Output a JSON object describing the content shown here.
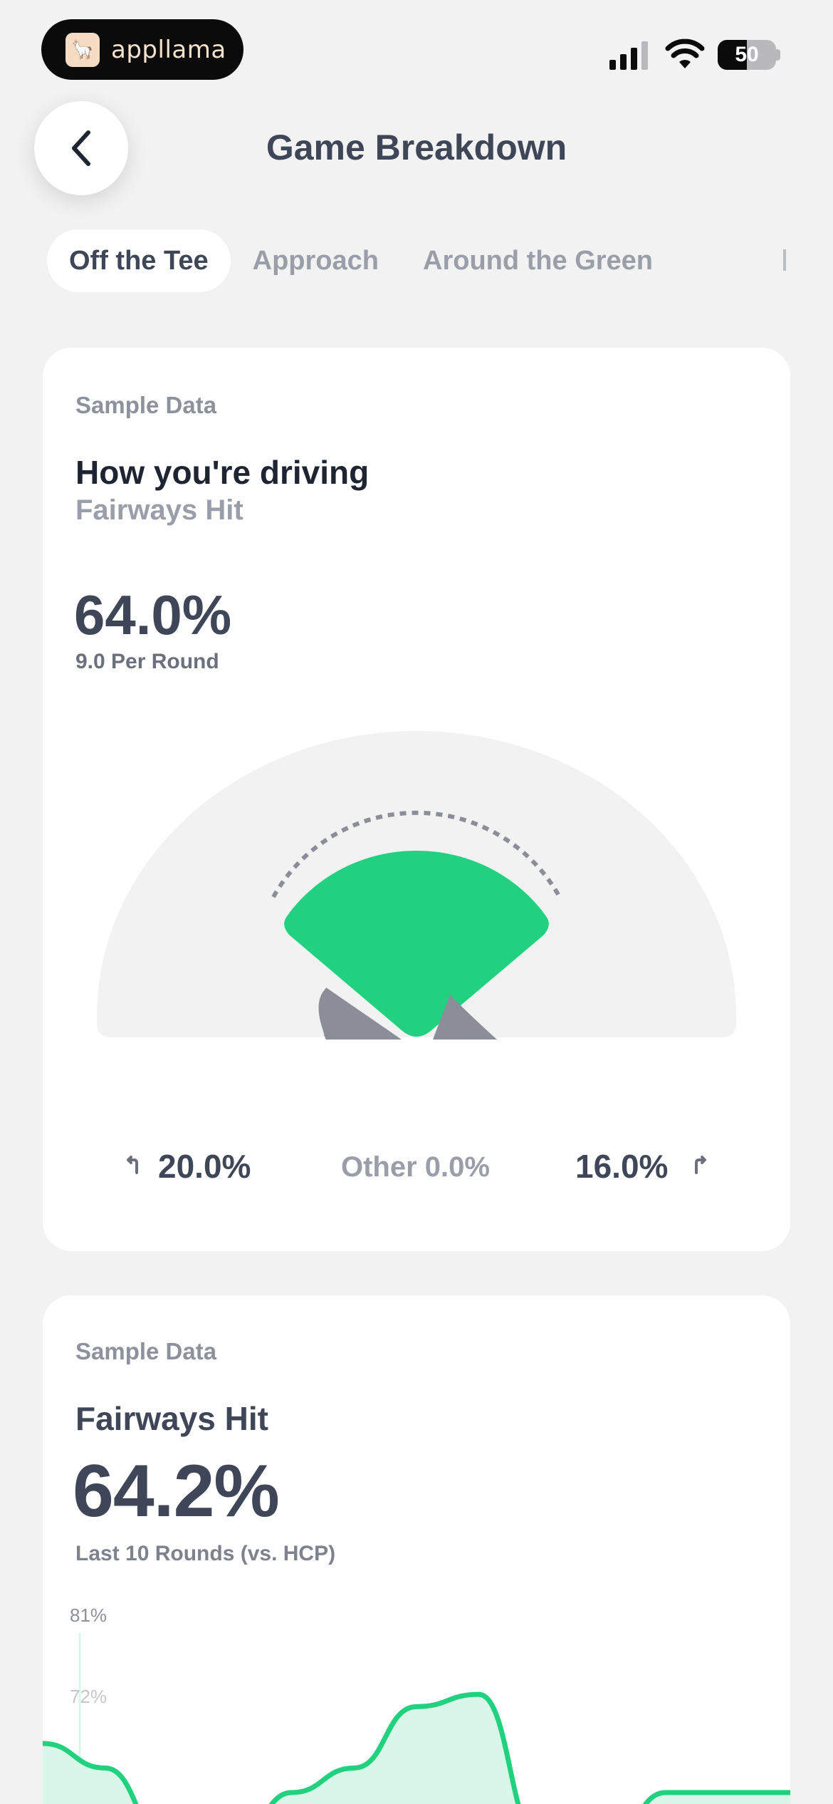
{
  "status_bar": {
    "app_badge": "appllama",
    "battery": "50"
  },
  "header": {
    "title": "Game Breakdown"
  },
  "tabs": [
    {
      "label": "Off the Tee",
      "active": true
    },
    {
      "label": "Approach",
      "active": false
    },
    {
      "label": "Around the Green",
      "active": false
    }
  ],
  "driving_card": {
    "tag": "Sample Data",
    "title": "How you're driving",
    "subtitle": "Fairways Hit",
    "percent": "64.0%",
    "per_round": "9.0 Per Round",
    "miss_left": "20.0%",
    "other": "Other 0.0%",
    "miss_right": "16.0%",
    "fairway_fraction": 0.64,
    "left_fraction": 0.2,
    "right_fraction": 0.16
  },
  "fairways_card": {
    "tag": "Sample Data",
    "title": "Fairways Hit",
    "value": "64.2%",
    "subtitle": "Last 10 Rounds (vs. HCP)",
    "y_labels": [
      "81%",
      "72%"
    ]
  },
  "colors": {
    "accent_green": "#22d17f",
    "fill_green": "#d9f7e8",
    "miss_gray": "#8b8e98",
    "arc_bg": "#f2f2f2",
    "text_dark": "#3f4657"
  },
  "chart_data": {
    "type": "area",
    "title": "Fairways Hit",
    "ylim": [
      63,
      81
    ],
    "y_ticks": [
      "81%",
      "72%"
    ],
    "series": [
      {
        "values": [
          72,
          70,
          64,
          63,
          68,
          70,
          75,
          76,
          64,
          63,
          68,
          68,
          68
        ]
      }
    ]
  }
}
